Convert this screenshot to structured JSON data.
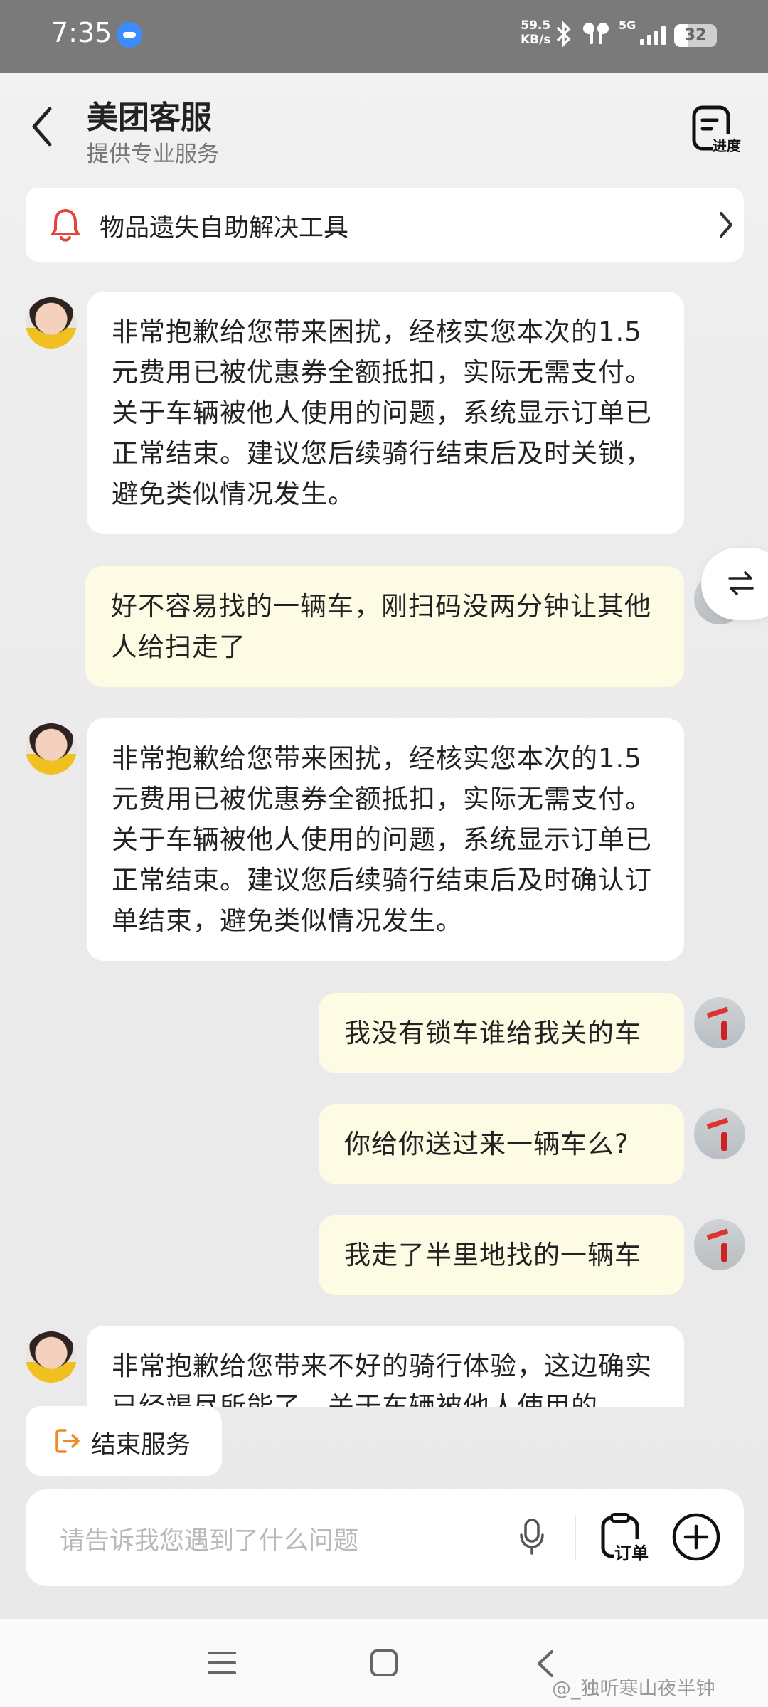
{
  "status_bar": {
    "time": "7:35",
    "net_speed_value": "59.5",
    "net_speed_unit": "KB/s",
    "network": "5G",
    "battery": "32"
  },
  "header": {
    "title": "美团客服",
    "subtitle": "提供专业服务",
    "progress_label": "进度"
  },
  "banner": {
    "text": "物品遗失自助解决工具",
    "icon": "bell-icon"
  },
  "messages": [
    {
      "from": "agent",
      "text": "非常抱歉给您带来困扰，经核实您本次的1.5元费用已被优惠券全额抵扣，实际无需支付。关于车辆被他人使用的问题，系统显示订单已正常结束。建议您后续骑行结束后及时关锁，避免类似情况发生。"
    },
    {
      "from": "user",
      "text": "好不容易找的一辆车，刚扫码没两分钟让其他人给扫走了"
    },
    {
      "from": "agent",
      "text": "非常抱歉给您带来困扰，经核实您本次的1.5元费用已被优惠券全额抵扣，实际无需支付。关于车辆被他人使用的问题，系统显示订单已正常结束。建议您后续骑行结束后及时确认订单结束，避免类似情况发生。"
    },
    {
      "from": "user",
      "text": "我没有锁车谁给我关的车"
    },
    {
      "from": "user",
      "text": "你给你送过来一辆车么?"
    },
    {
      "from": "user",
      "text": "我走了半里地找的一辆车"
    },
    {
      "from": "agent",
      "text": "非常抱歉给您带来不好的骑行体验，这边确实已经竭尽所能了，关于车辆被他人使用的"
    }
  ],
  "end_service_label": "结束服务",
  "input": {
    "placeholder": "请告诉我您遇到了什么问题",
    "order_label": "订单"
  },
  "watermark": "@_独听寒山夜半钟",
  "colors": {
    "user_bubble": "#fdfbe3",
    "agent_bubble": "#ffffff",
    "accent_orange": "#f08a24",
    "bell_red": "#e8433a"
  }
}
